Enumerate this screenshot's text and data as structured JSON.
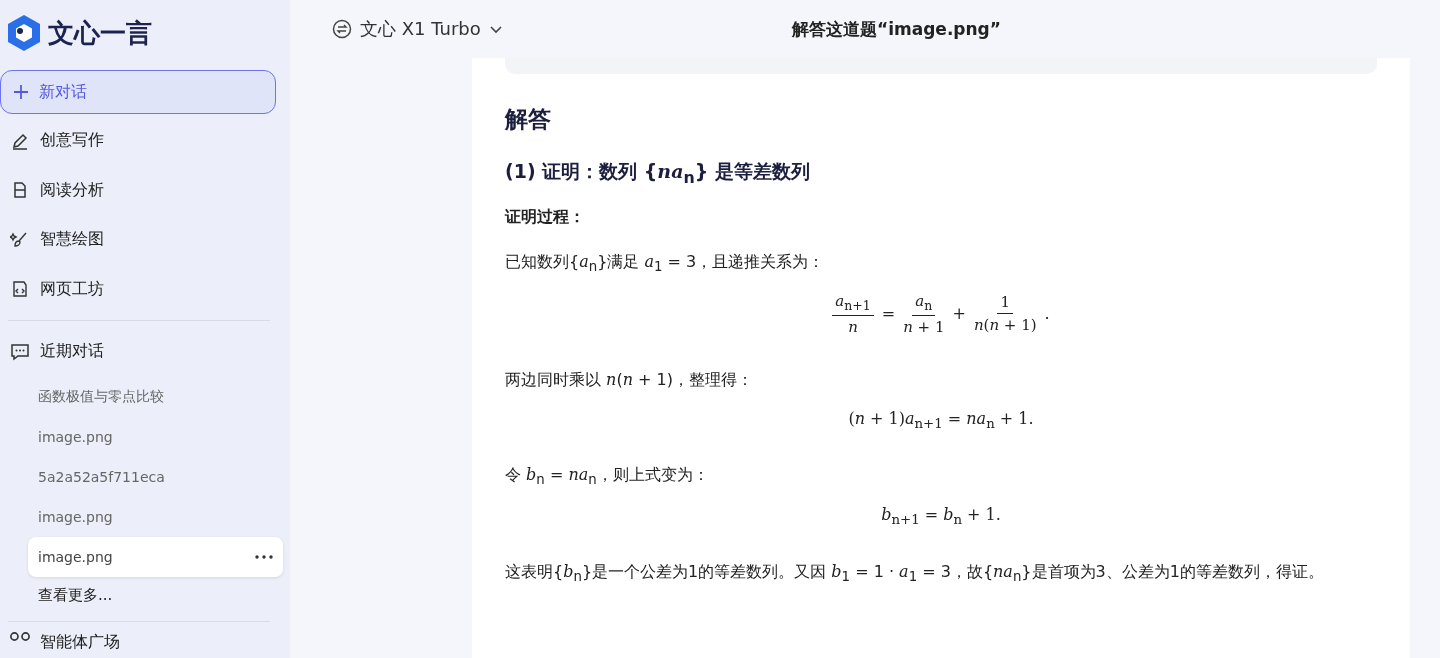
{
  "sidebar": {
    "logo_text": "文心一言",
    "new_chat": {
      "label": "新对话",
      "selected": true
    },
    "nav": [
      {
        "label": "创意写作"
      },
      {
        "label": "阅读分析"
      },
      {
        "label": "智慧绘图"
      },
      {
        "label": "网页工坊"
      }
    ],
    "recent": {
      "label": "近期对话",
      "items": [
        {
          "label": "函数极值与零点比较",
          "selected": false
        },
        {
          "label": "image.png",
          "selected": false
        },
        {
          "label": "5a2a52a5f711eca",
          "selected": false
        },
        {
          "label": "image.png",
          "selected": false
        },
        {
          "label": "image.png",
          "selected": true
        }
      ],
      "more": "查看更多..."
    },
    "bottom": {
      "label": "智能体广场"
    }
  },
  "header": {
    "model": "文心 X1 Turbo",
    "title": "解答这道题“image.png”"
  },
  "answer": {
    "heading": "解答",
    "subheading": "(1) 证明：数列 {*na*$_{n}$} 是等差数列",
    "blocks": [
      {
        "kind": "label",
        "text": "证明过程："
      },
      {
        "kind": "para",
        "text": "已知数列{*a*$_{n}$}满足 *a*$_{1}$ = 3，且递推关系为："
      },
      {
        "kind": "eq",
        "terms": [
          {
            "kind": "frac",
            "num": "*a*$_{n+1}$",
            "den": "*n*"
          },
          {
            "kind": "text",
            "text": "="
          },
          {
            "kind": "frac",
            "num": "*a*$_{n}$",
            "den": "*n* + 1"
          },
          {
            "kind": "text",
            "text": "+"
          },
          {
            "kind": "frac",
            "num": "1",
            "den": "*n*(*n* + 1)"
          },
          {
            "kind": "text",
            "text": "."
          }
        ]
      },
      {
        "kind": "para",
        "text": "两边同时乘以 *n*(*n* + 1)，整理得："
      },
      {
        "kind": "eq",
        "terms": [
          {
            "kind": "text",
            "text": "(*n* + 1)*a*$_{n+1}$ = *na*$_{n}$ + 1."
          }
        ]
      },
      {
        "kind": "para",
        "text": "令 *b*$_{n}$ = *na*$_{n}$，则上式变为："
      },
      {
        "kind": "eq",
        "terms": [
          {
            "kind": "text",
            "text": "*b*$_{n+1}$ = *b*$_{n}$ + 1."
          }
        ]
      },
      {
        "kind": "para",
        "text": "这表明{*b*$_{n}$}是一个公差为1的等差数列。又因 *b*$_{1}$ = 1 · *a*$_{1}$ = 3，故{*na*$_{n}$}是首项为3、公差为1的等差数列，得证。"
      }
    ]
  }
}
